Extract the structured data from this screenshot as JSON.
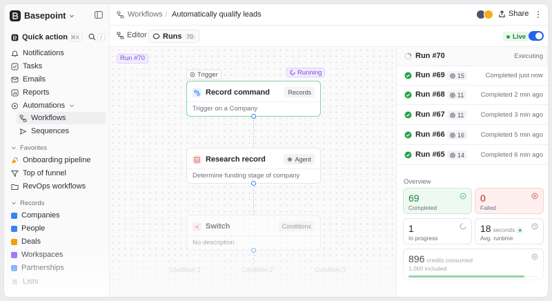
{
  "workspace": {
    "name": "Basepoint"
  },
  "quick_actions": {
    "label": "Quick actions",
    "shortcut": "⌘K",
    "search_shortcut": "/"
  },
  "sidebar": {
    "nav": [
      "Notifications",
      "Tasks",
      "Emails",
      "Reports",
      "Automations"
    ],
    "automations_sub": [
      "Workflows",
      "Sequences"
    ],
    "favorites_label": "Favorites",
    "favorites": [
      "Onboarding pipeline",
      "Top of funnel",
      "RevOps workflows"
    ],
    "records_label": "Records",
    "records": [
      "Companies",
      "People",
      "Deals",
      "Workspaces",
      "Partnerships",
      "Lists"
    ],
    "colors": {
      "companies": "#3b82f6",
      "people": "#3b82f6",
      "deals": "#f59e0b",
      "workspaces": "#8b5cf6",
      "partnerships": "#3b82f6"
    }
  },
  "breadcrumb": {
    "parent": "Workflows",
    "current": "Automatically qualify leads"
  },
  "header": {
    "share_label": "Share"
  },
  "tabs": {
    "editor": "Editor",
    "runs": "Runs",
    "runs_count": "70"
  },
  "live": {
    "label": "Live",
    "enabled": true
  },
  "canvas": {
    "run_tag": "Run #70",
    "trigger_label": "Trigger",
    "running_label": "Running",
    "nodes": [
      {
        "title": "Record command",
        "badge": "Records",
        "desc": "Trigger on a Company"
      },
      {
        "title": "Research record",
        "badge": "Agent",
        "desc": "Determine funding stage of company"
      },
      {
        "title": "Switch",
        "badge": "Conditions",
        "desc": "No description"
      }
    ],
    "conditions": [
      "Condition 1",
      "Condition 2",
      "Condition 3"
    ]
  },
  "runs": [
    {
      "name": "Run #70",
      "credits": "",
      "status": "Executing",
      "state": "executing"
    },
    {
      "name": "Run #69",
      "credits": "15",
      "status": "Completed just now",
      "state": "done"
    },
    {
      "name": "Run #68",
      "credits": "11",
      "status": "Completed 2 min ago",
      "state": "done"
    },
    {
      "name": "Run #67",
      "credits": "11",
      "status": "Completed 3 min ago",
      "state": "done"
    },
    {
      "name": "Run #66",
      "credits": "16",
      "status": "Completed 5 min ago",
      "state": "done"
    },
    {
      "name": "Run #65",
      "credits": "14",
      "status": "Completed 6 min ago",
      "state": "done"
    }
  ],
  "overview": {
    "title": "Overview",
    "completed": {
      "value": "69",
      "label": "Completed"
    },
    "failed": {
      "value": "0",
      "label": "Failed"
    },
    "in_progress": {
      "value": "1",
      "label": "In progress"
    },
    "avg_runtime": {
      "value": "18",
      "unit": "seconds",
      "label": "Avg. runtime"
    },
    "credits": {
      "value": "896",
      "unit": "credits consumed",
      "label": "1,000 included"
    }
  }
}
